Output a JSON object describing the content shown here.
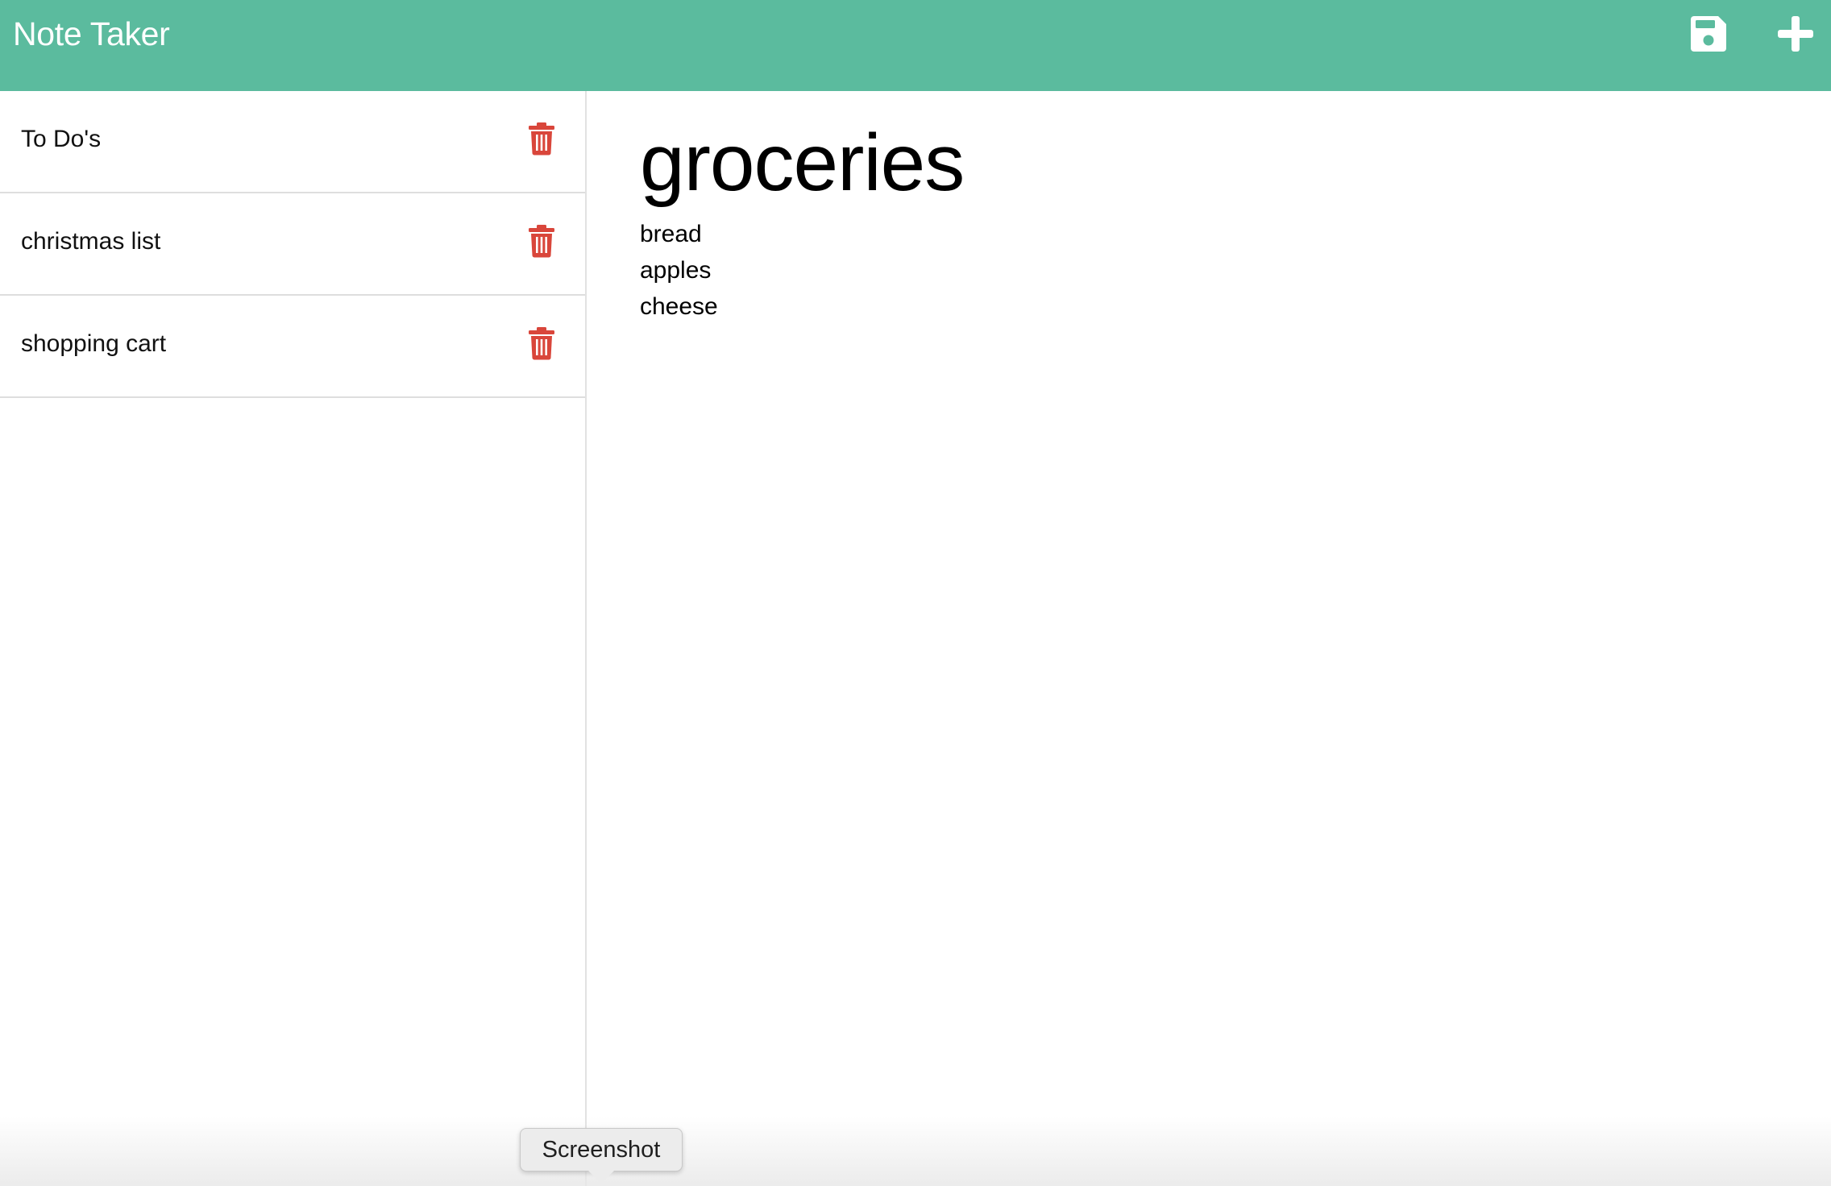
{
  "app": {
    "title": "Note Taker",
    "accent_color": "#5bbb9e",
    "delete_color": "#d9463b"
  },
  "toolbar": {
    "save_icon": "floppy-disk-icon",
    "new_icon": "plus-icon"
  },
  "sidebar": {
    "notes": [
      {
        "title": "To Do's",
        "icon": "trash-icon"
      },
      {
        "title": "christmas list",
        "icon": "trash-icon"
      },
      {
        "title": "shopping cart",
        "icon": "trash-icon"
      }
    ]
  },
  "editor": {
    "title": "groceries",
    "body": "bread\napples\ncheese"
  },
  "tooltip": {
    "label": "Screenshot"
  }
}
